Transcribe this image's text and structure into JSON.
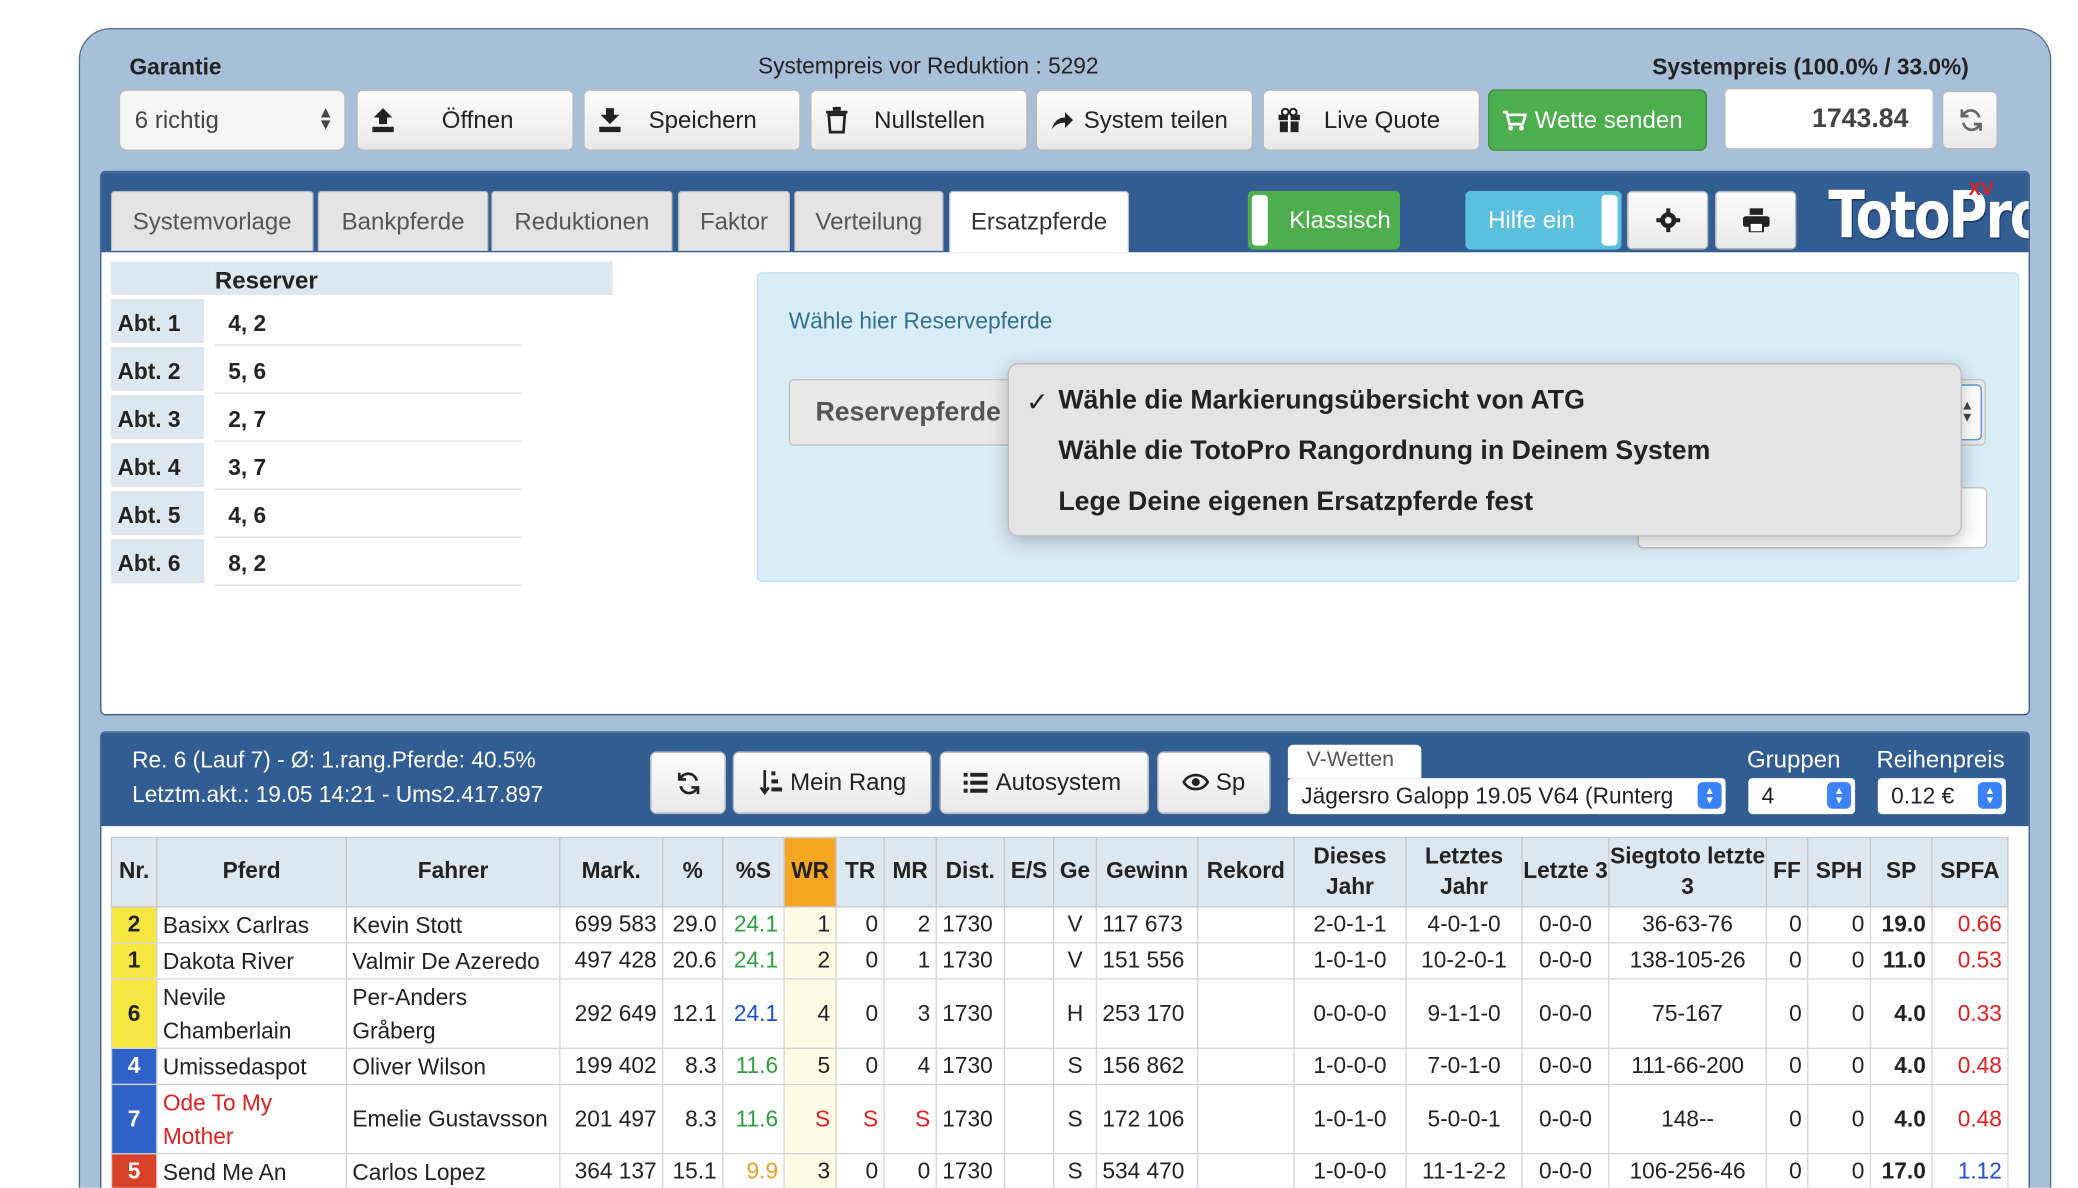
{
  "top": {
    "garantie_label": "Garantie",
    "systempreis_vor": "Systempreis vor Reduktion : 5292",
    "systempreis_label": "Systempreis (100.0% / 33.0%)",
    "garantie_select": "6 richtig",
    "buttons": {
      "oeffnen": "Öffnen",
      "speichern": "Speichern",
      "nullstellen": "Nullstellen",
      "teilen": "System teilen",
      "live": "Live Quote",
      "senden": "Wette senden"
    },
    "price_value": "1743.84"
  },
  "tabs": [
    "Systemvorlage",
    "Bankpferde",
    "Reduktionen",
    "Faktor",
    "Verteilung",
    "Ersatzpferde"
  ],
  "toggles": {
    "klassisch": "Klassisch",
    "hilfe": "Hilfe ein"
  },
  "logo": {
    "text": "TotoPro",
    "badge": "XV"
  },
  "reserver": {
    "header": "Reserver",
    "rows": [
      {
        "abt": "Abt. 1",
        "val": "4, 2"
      },
      {
        "abt": "Abt. 2",
        "val": "5, 6"
      },
      {
        "abt": "Abt. 3",
        "val": "2, 7"
      },
      {
        "abt": "Abt. 4",
        "val": "3, 7"
      },
      {
        "abt": "Abt. 5",
        "val": "4, 6"
      },
      {
        "abt": "Abt. 6",
        "val": "8, 2"
      }
    ]
  },
  "reserve_box": {
    "title": "Wähle hier Reservepferde",
    "select_label": "Reservepferde",
    "options": [
      "Wähle die Markierungsübersicht von ATG",
      "Wähle die TotoPro Rangordnung in Deinem System",
      "Lege Deine eigenen Ersatzpferde fest"
    ],
    "selected_mark": "✓"
  },
  "race_info": {
    "line1": "Re. 6 (Lauf 7) - Ø: 1.rang.Pferde: 40.5%",
    "line2": "Letztm.akt.: 19.05 14:21 - Ums2.417.897",
    "buttons": {
      "mein_rang": "Mein Rang",
      "autosystem": "Autosystem",
      "sp": "Sp"
    },
    "vwetten_label": "V-Wetten",
    "vwetten_value": "Jägersro Galopp 19.05 V64 (Runterg",
    "gruppen_label": "Gruppen",
    "gruppen_value": "4",
    "reihenpreis_label": "Reihenpreis",
    "reihenpreis_value": "0.12 €"
  },
  "table": {
    "headers": [
      "Nr.",
      "Pferd",
      "Fahrer",
      "Mark.",
      "%",
      "%S",
      "WR",
      "TR",
      "MR",
      "Dist.",
      "E/S",
      "Ge",
      "Gewinn",
      "Rekord",
      "Dieses Jahr",
      "Letztes Jahr",
      "Letzte 3",
      "Siegtoto letzte 3",
      "FF",
      "SPH",
      "SP",
      "SPFA"
    ],
    "rows": [
      {
        "nr": "2",
        "nr_color": "#f5e642",
        "nr_text": "#222",
        "pferd": "Basixx Carlras",
        "fahrer": "Kevin Stott",
        "mark": "699 583",
        "pct": "29.0",
        "pcts": "24.1",
        "pcts_color": "#2e9e3e",
        "wr": "1",
        "tr": "0",
        "mr": "2",
        "dist": "1730",
        "es": "",
        "ge": "V",
        "gewinn": "117 673",
        "rekord": "",
        "dj": "2-0-1-1",
        "lj": "4-0-1-0",
        "l3": "0-0-0",
        "st": "36-63-76",
        "ff": "0",
        "sph": "0",
        "sp": "19.0",
        "spfa": "0.66",
        "spfa_color": "#e02020"
      },
      {
        "nr": "1",
        "nr_color": "#f5e642",
        "nr_text": "#222",
        "pferd": "Dakota River",
        "fahrer": "Valmir De Azeredo",
        "mark": "497 428",
        "pct": "20.6",
        "pcts": "24.1",
        "pcts_color": "#2e9e3e",
        "wr": "2",
        "tr": "0",
        "mr": "1",
        "dist": "1730",
        "es": "",
        "ge": "V",
        "gewinn": "151 556",
        "rekord": "",
        "dj": "1-0-1-0",
        "lj": "10-2-0-1",
        "l3": "0-0-0",
        "st": "138-105-26",
        "ff": "0",
        "sph": "0",
        "sp": "11.0",
        "spfa": "0.53",
        "spfa_color": "#e02020"
      },
      {
        "nr": "6",
        "nr_color": "#f5e642",
        "nr_text": "#222",
        "pferd": "Nevile Chamberlain",
        "fahrer": "Per-Anders Gråberg",
        "mark": "292 649",
        "pct": "12.1",
        "pcts": "24.1",
        "pcts_color": "#1a4fd6",
        "wr": "4",
        "tr": "0",
        "mr": "3",
        "dist": "1730",
        "es": "",
        "ge": "H",
        "gewinn": "253 170",
        "rekord": "",
        "dj": "0-0-0-0",
        "lj": "9-1-1-0",
        "l3": "0-0-0",
        "st": "75-167",
        "ff": "0",
        "sph": "0",
        "sp": "4.0",
        "spfa": "0.33",
        "spfa_color": "#e02020"
      },
      {
        "nr": "4",
        "nr_color": "#2f62c8",
        "nr_text": "#fff",
        "pferd": "Umissedaspot",
        "fahrer": "Oliver Wilson",
        "mark": "199 402",
        "pct": "8.3",
        "pcts": "11.6",
        "pcts_color": "#2e9e3e",
        "wr": "5",
        "tr": "0",
        "mr": "4",
        "dist": "1730",
        "es": "",
        "ge": "S",
        "gewinn": "156 862",
        "rekord": "",
        "dj": "1-0-0-0",
        "lj": "7-0-1-0",
        "l3": "0-0-0",
        "st": "111-66-200",
        "ff": "0",
        "sph": "0",
        "sp": "4.0",
        "spfa": "0.48",
        "spfa_color": "#e02020"
      },
      {
        "nr": "7",
        "nr_color": "#2f62c8",
        "nr_text": "#fff",
        "pferd": "Ode To My Mother",
        "pferd_color": "#e02020",
        "fahrer": "Emelie Gustavsson",
        "mark": "201 497",
        "pct": "8.3",
        "pcts": "11.6",
        "pcts_color": "#2e9e3e",
        "wr": "S",
        "tr": "S",
        "mr": "S",
        "wr_color": "#e02020",
        "dist": "1730",
        "es": "",
        "ge": "S",
        "gewinn": "172 106",
        "rekord": "",
        "dj": "1-0-1-0",
        "lj": "5-0-0-1",
        "l3": "0-0-0",
        "st": "148--",
        "ff": "0",
        "sph": "0",
        "sp": "4.0",
        "spfa": "0.48",
        "spfa_color": "#e02020"
      },
      {
        "nr": "5",
        "nr_color": "#d9412b",
        "nr_text": "#fff",
        "pferd": "Send Me An",
        "fahrer": "Carlos Lopez",
        "mark": "364 137",
        "pct": "15.1",
        "pcts": "9.9",
        "pcts_color": "#e8a020",
        "wr": "3",
        "tr": "0",
        "mr": "0",
        "dist": "1730",
        "es": "",
        "ge": "S",
        "gewinn": "534 470",
        "rekord": "",
        "dj": "1-0-0-0",
        "lj": "11-1-2-2",
        "l3": "0-0-0",
        "st": "106-256-46",
        "ff": "0",
        "sph": "0",
        "sp": "17.0",
        "spfa": "1.12",
        "spfa_color": "#1a4fd6"
      }
    ]
  }
}
